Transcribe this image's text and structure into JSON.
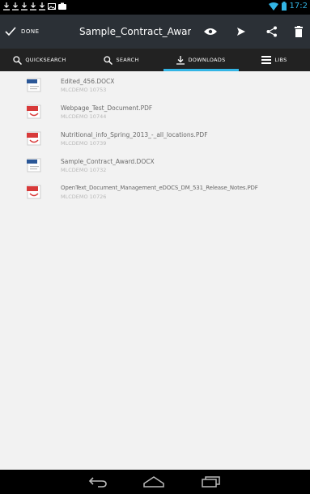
{
  "status_bar": {
    "time": "17:2",
    "icons": [
      "download-icon",
      "download-icon",
      "download-icon",
      "download-icon",
      "download-icon",
      "image-icon",
      "photo-icon"
    ],
    "accent_color": "#33b5e5"
  },
  "action_bar": {
    "done_label": "DONE",
    "title": "Sample_Contract_Awar...",
    "actions": [
      "eye-icon",
      "send-icon",
      "share-icon",
      "trash-icon"
    ]
  },
  "tabs": [
    {
      "label": "QUICKSEARCH",
      "icon": "search-icon",
      "active": false
    },
    {
      "label": "SEARCH",
      "icon": "search-icon",
      "active": false
    },
    {
      "label": "DOWNLOADS",
      "icon": "download-icon",
      "active": true
    },
    {
      "label": "LIBS",
      "icon": "list-icon",
      "active": false
    }
  ],
  "documents": [
    {
      "name": "Edited_456.DOCX",
      "meta": "MLCDEMO 10753",
      "type": "docx"
    },
    {
      "name": "Webpage_Test_Document.PDF",
      "meta": "MLCDEMO 10744",
      "type": "pdf"
    },
    {
      "name": "Nutritional_info_Spring_2013_-_all_locations.PDF",
      "meta": "MLCDEMO 10739",
      "type": "pdf"
    },
    {
      "name": "Sample_Contract_Award.DOCX",
      "meta": "MLCDEMO 10732",
      "type": "docx"
    },
    {
      "name": "OpenText_Document_Management_eDOCS_DM_531_Release_Notes.PDF",
      "meta": "MLCDEMO 10726",
      "type": "pdf"
    }
  ],
  "nav_bar": [
    "back-icon",
    "home-icon",
    "recent-apps-icon"
  ]
}
